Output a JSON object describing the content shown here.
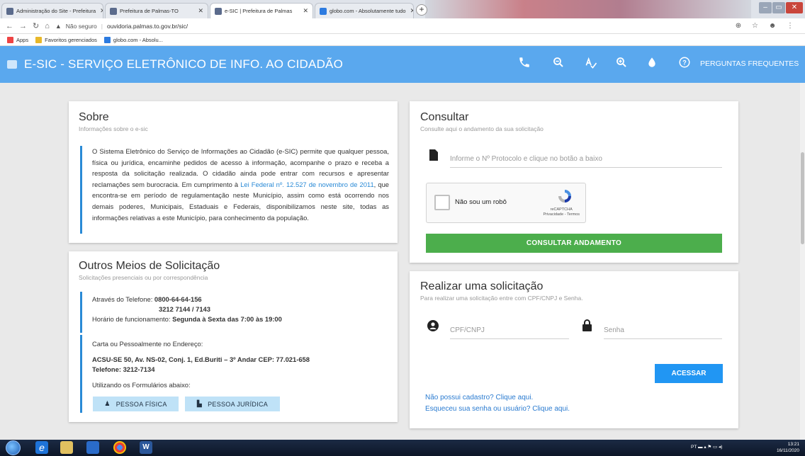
{
  "browser": {
    "tabs": [
      {
        "label": "Administração do Site - Prefeitura",
        "favicon_color": "#5b6b8c",
        "active": false
      },
      {
        "label": "Prefeitura de Palmas-TO",
        "favicon_color": "#5b6b8c",
        "active": false
      },
      {
        "label": "e-SIC | Prefeitura de Palmas",
        "favicon_color": "#5b6b8c",
        "active": true
      },
      {
        "label": "globo.com - Absolutamente tudo",
        "favicon_color": "#2d7be0",
        "active": false
      }
    ],
    "new_tab": "+",
    "security_label": "Não seguro",
    "url": "ouvidoria.palmas.to.gov.br/sic/",
    "bookmarks": [
      {
        "label": "Apps",
        "color": "#e44"
      },
      {
        "label": "Favoritos gerenciados",
        "color": "#e8b82a"
      },
      {
        "label": "globo.com - Absolu...",
        "color": "#2d7be0"
      }
    ]
  },
  "header": {
    "title": "E-SIC - SERVIÇO ELETRÔNICO DE INFO. AO CIDADÃO",
    "faq_label": "PERGUNTAS FREQUENTES",
    "accent_color": "#5aa8ee"
  },
  "about": {
    "title": "Sobre",
    "subtitle": "Informações sobre o e-sic",
    "text_before_link": "O Sistema Eletrônico do Serviço de Informações ao Cidadão (e-SIC) permite que qualquer pessoa, física ou jurídica, encaminhe pedidos de acesso à informação, acompanhe o prazo e receba a resposta da solicitação realizada. O cidadão ainda pode entrar com recursos e apresentar reclamações sem burocracia. Em cumprimento à ",
    "link_text": "Lei Federal nº. 12.527 de novembro de 2011",
    "text_after_link": ", que encontra-se em período de regulamentação neste Município, assim como está ocorrendo nos demais poderes, Municipais, Estaduais e Federais, disponibilizamos neste site, todas as informações relativas a este Município, para conhecimento da população."
  },
  "other_means": {
    "title": "Outros Meios de Solicitação",
    "subtitle": "Solicitações presenciais ou por correspondência",
    "phone_prefix": "Através do Telefone: ",
    "phone_1": "0800-64-64-156",
    "phone_2": "3212 7144 / 7143",
    "hours_prefix": "Horário de funcionamento: ",
    "hours": "Segunda à Sexta das 7:00 às 19:00",
    "address_intro": "Carta ou Pessoalmente no Endereço:",
    "address": "ACSU-SE 50, Av. NS-02, Conj. 1, Ed.Buriti – 3º Andar CEP: 77.021-658",
    "address_phone": "Telefone: 3212-7134",
    "forms_intro": "Utilizando os Formulários abaixo:",
    "btn_pf": "PESSOA FÍSICA",
    "btn_pj": "PESSOA JURÍDICA"
  },
  "consult": {
    "title": "Consultar",
    "subtitle": "Consulte aqui o andamento da sua solicitação",
    "protocol_placeholder": "Informe o Nº Protocolo e clique no botão a baixo",
    "captcha_label": "Não sou um robô",
    "captcha_brand": "reCAPTCHA",
    "captcha_links": "Privacidade - Termos",
    "button": "CONSULTAR ANDAMENTO",
    "button_color": "#4cae4c"
  },
  "request": {
    "title": "Realizar uma solicitação",
    "subtitle": "Para realizar uma solicitação entre com CPF/CNPJ e Senha.",
    "cpf_placeholder": "CPF/CNPJ",
    "password_placeholder": "Senha",
    "button": "ACESSAR",
    "link_register": "Não possui cadastro? Clique aqui.",
    "link_forgot": "Esqueceu sua senha ou usuário? Clique aqui."
  },
  "taskbar": {
    "language": "PT",
    "time": "13:21",
    "date": "16/11/2020"
  }
}
